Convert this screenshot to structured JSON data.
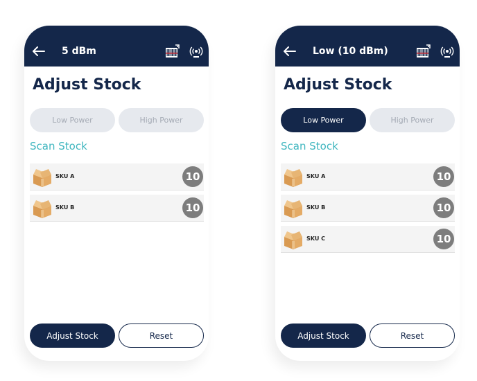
{
  "screens": [
    {
      "header": {
        "title": "5 dBm"
      },
      "page_title": "Adjust Stock",
      "power": {
        "low_label": "Low Power",
        "high_label": "High Power",
        "selected": "none"
      },
      "section_title": "Scan Stock",
      "items": [
        {
          "sku": "SKU A",
          "count": "10"
        },
        {
          "sku": "SKU B",
          "count": "10"
        }
      ],
      "actions": {
        "primary_label": "Adjust Stock",
        "secondary_label": "Reset"
      }
    },
    {
      "header": {
        "title": "Low (10 dBm)"
      },
      "page_title": "Adjust Stock",
      "power": {
        "low_label": "Low Power",
        "high_label": "High Power",
        "selected": "low"
      },
      "section_title": "Scan Stock",
      "items": [
        {
          "sku": "SKU A",
          "count": "10"
        },
        {
          "sku": "SKU B",
          "count": "10"
        },
        {
          "sku": "SKU C",
          "count": "10"
        }
      ],
      "actions": {
        "primary_label": "Adjust Stock",
        "secondary_label": "Reset"
      }
    }
  ],
  "icons": {
    "back": "arrow-left-icon",
    "barcode": "barcode-scanner-icon",
    "rfid": "rfid-icon",
    "item": "cardboard-box-icon"
  },
  "colors": {
    "navy": "#14274a",
    "teal": "#3fb6bf",
    "toggle_inactive": "#e6e9ee",
    "count_badge": "#7d7d7d",
    "accent_red": "#d0202a"
  }
}
